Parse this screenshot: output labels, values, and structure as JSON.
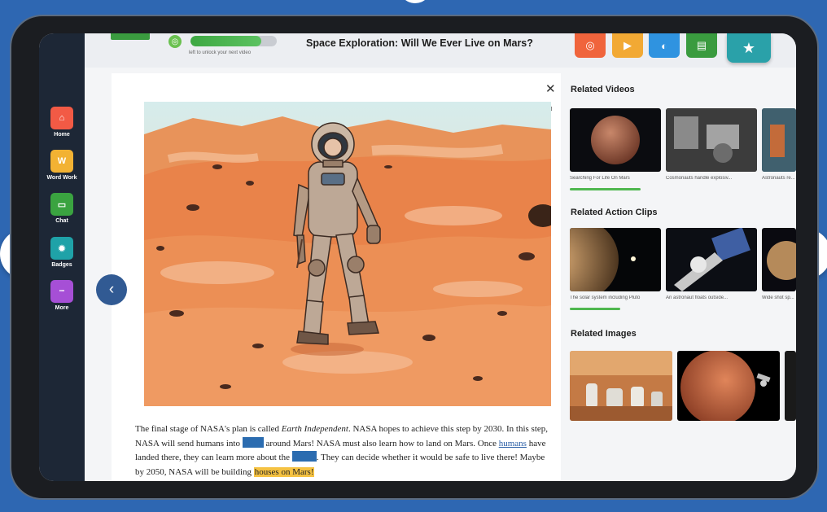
{
  "sidebar": {
    "items": [
      {
        "label": "Home",
        "icon": "home-icon",
        "color": "#f25a45",
        "glyph": "⌂"
      },
      {
        "label": "Word Work",
        "icon": "word-work-icon",
        "color": "#f2b233",
        "glyph": "W"
      },
      {
        "label": "Chat",
        "icon": "chat-icon",
        "color": "#3aa340",
        "glyph": "▭"
      },
      {
        "label": "Badges",
        "icon": "badge-icon",
        "color": "#1fa2a8",
        "glyph": "✹"
      },
      {
        "label": "More",
        "icon": "more-icon",
        "color": "#a64fd6",
        "glyph": "•••"
      }
    ]
  },
  "header": {
    "title": "Space Exploration: Will We Ever Live on Mars?",
    "progress_caption": "left to unlock your next video",
    "progress_fraction": 0.82,
    "tools": [
      {
        "name": "target-tool-button",
        "icon": "target-icon",
        "color": "#f0643c",
        "glyph": "◎"
      },
      {
        "name": "play-tool-button",
        "icon": "play-icon",
        "color": "#f2a934",
        "glyph": "▶"
      },
      {
        "name": "listen-tool-button",
        "icon": "ear-icon",
        "color": "#2f93e0",
        "glyph": "◐"
      },
      {
        "name": "read-tool-button",
        "icon": "book-icon",
        "color": "#3a9b3f",
        "glyph": "▤"
      }
    ],
    "favorite_icon": "star-icon"
  },
  "story": {
    "part1": "The final stage of NASA's plan is called ",
    "title_em": "Earth Independent",
    "part2": ". NASA hopes to achieve this step by 2030. In this step, NASA will send humans into ",
    "part3": " around Mars! NASA must also learn how to land on Mars. Once ",
    "link_word": "humans",
    "part4": " have landed there, they can learn more about the ",
    "part5": ". They can decide whether it would be safe to live there! Maybe by 2050, NASA will be building ",
    "highlight": "houses on Mars!"
  },
  "related_videos": {
    "title": "Related Videos",
    "items": [
      {
        "caption": "Searching For Life On Mars"
      },
      {
        "caption": "Cosmonauts handle explosiv..."
      },
      {
        "caption": "Astronauts re..."
      }
    ],
    "watched_fraction": 0.78
  },
  "related_clips": {
    "title": "Related Action Clips",
    "items": [
      {
        "caption": "The solar system including Pluto"
      },
      {
        "caption": "An astronaut floats outside..."
      },
      {
        "caption": "Wide shot sp..."
      }
    ],
    "watched_fraction": 0.55
  },
  "related_images": {
    "title": "Related Images"
  },
  "colors": {
    "background": "#2e67b2",
    "sidebar": "#1d2736",
    "blank": "#2b6cb0",
    "highlight": "#f5c242",
    "progress": "#3ea843"
  }
}
